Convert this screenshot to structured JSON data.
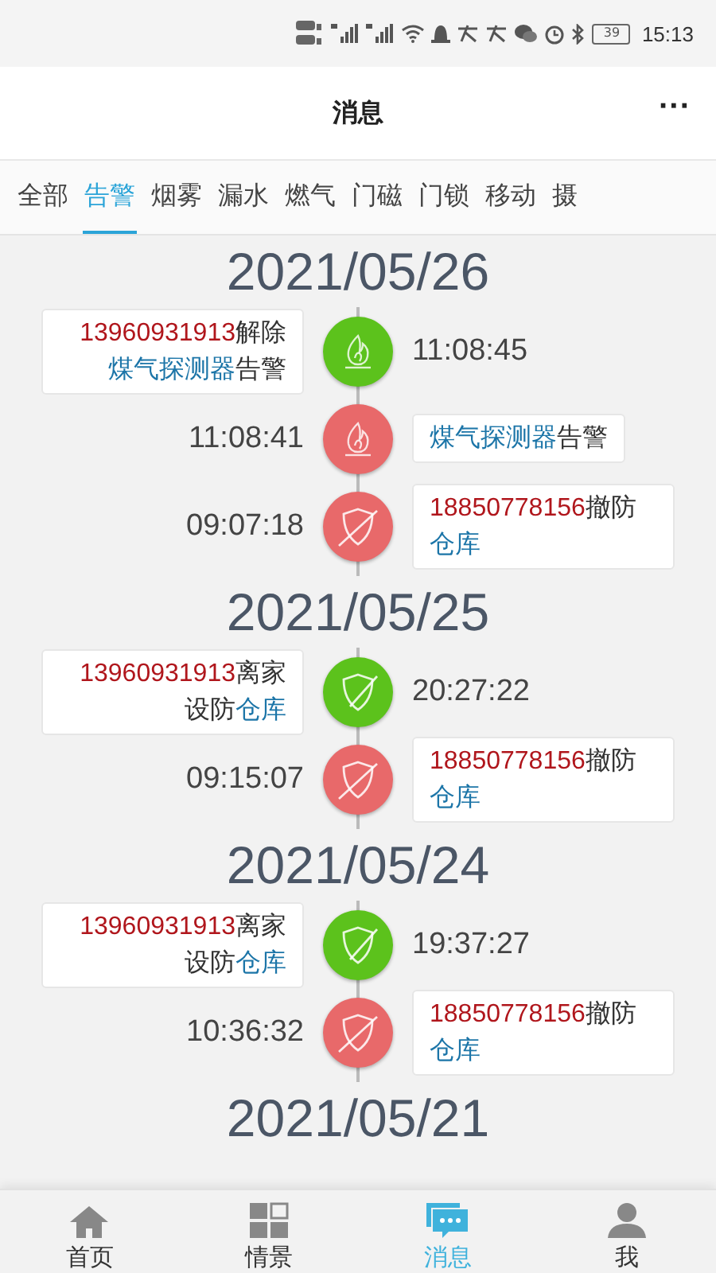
{
  "status_bar": {
    "battery": "39",
    "time": "15:13"
  },
  "header": {
    "title": "消息",
    "menu": "···"
  },
  "tabs": [
    {
      "label": "全部",
      "selected": false
    },
    {
      "label": "告警",
      "selected": true
    },
    {
      "label": "烟雾",
      "selected": false
    },
    {
      "label": "漏水",
      "selected": false
    },
    {
      "label": "燃气",
      "selected": false
    },
    {
      "label": "门磁",
      "selected": false
    },
    {
      "label": "门锁",
      "selected": false
    },
    {
      "label": "移动",
      "selected": false
    },
    {
      "label": "摄",
      "selected": false
    }
  ],
  "days": [
    {
      "date": "2021/05/26",
      "events": [
        {
          "kind": "alarm_cleared",
          "time": "11:08:45",
          "message": [
            {
              "kind": "phone",
              "text": "13960931913"
            },
            {
              "kind": "plain",
              "text": "解除"
            },
            {
              "kind": "device",
              "text": "煤气探测器"
            },
            {
              "kind": "plain",
              "text": "告警"
            }
          ]
        },
        {
          "kind": "alarm",
          "time": "11:08:41",
          "message": [
            {
              "kind": "device",
              "text": "煤气探测器"
            },
            {
              "kind": "plain",
              "text": "告警"
            }
          ]
        },
        {
          "kind": "disarm",
          "time": "09:07:18",
          "message": [
            {
              "kind": "phone",
              "text": "18850778156"
            },
            {
              "kind": "plain",
              "text": "撤防"
            },
            {
              "kind": "device",
              "text": "仓库"
            }
          ]
        }
      ]
    },
    {
      "date": "2021/05/25",
      "events": [
        {
          "kind": "arm",
          "time": "20:27:22",
          "message": [
            {
              "kind": "phone",
              "text": "13960931913"
            },
            {
              "kind": "plain",
              "text": "离家设防"
            },
            {
              "kind": "device",
              "text": "仓库"
            }
          ]
        },
        {
          "kind": "disarm",
          "time": "09:15:07",
          "message": [
            {
              "kind": "phone",
              "text": "18850778156"
            },
            {
              "kind": "plain",
              "text": "撤防"
            },
            {
              "kind": "device",
              "text": "仓库"
            }
          ]
        }
      ]
    },
    {
      "date": "2021/05/24",
      "events": [
        {
          "kind": "arm",
          "time": "19:37:27",
          "message": [
            {
              "kind": "phone",
              "text": "13960931913"
            },
            {
              "kind": "plain",
              "text": "离家设防"
            },
            {
              "kind": "device",
              "text": "仓库"
            }
          ]
        },
        {
          "kind": "disarm",
          "time": "10:36:32",
          "message": [
            {
              "kind": "phone",
              "text": "18850778156"
            },
            {
              "kind": "plain",
              "text": "撤防"
            },
            {
              "kind": "device",
              "text": "仓库"
            }
          ]
        }
      ]
    },
    {
      "date": "2021/05/21"
    }
  ],
  "nav": [
    {
      "label": "首页",
      "kind": "home",
      "selected": false
    },
    {
      "label": "情景",
      "kind": "scenes",
      "selected": false
    },
    {
      "label": "消息",
      "kind": "messages",
      "selected": true
    },
    {
      "label": "我",
      "kind": "profile",
      "selected": false
    }
  ]
}
